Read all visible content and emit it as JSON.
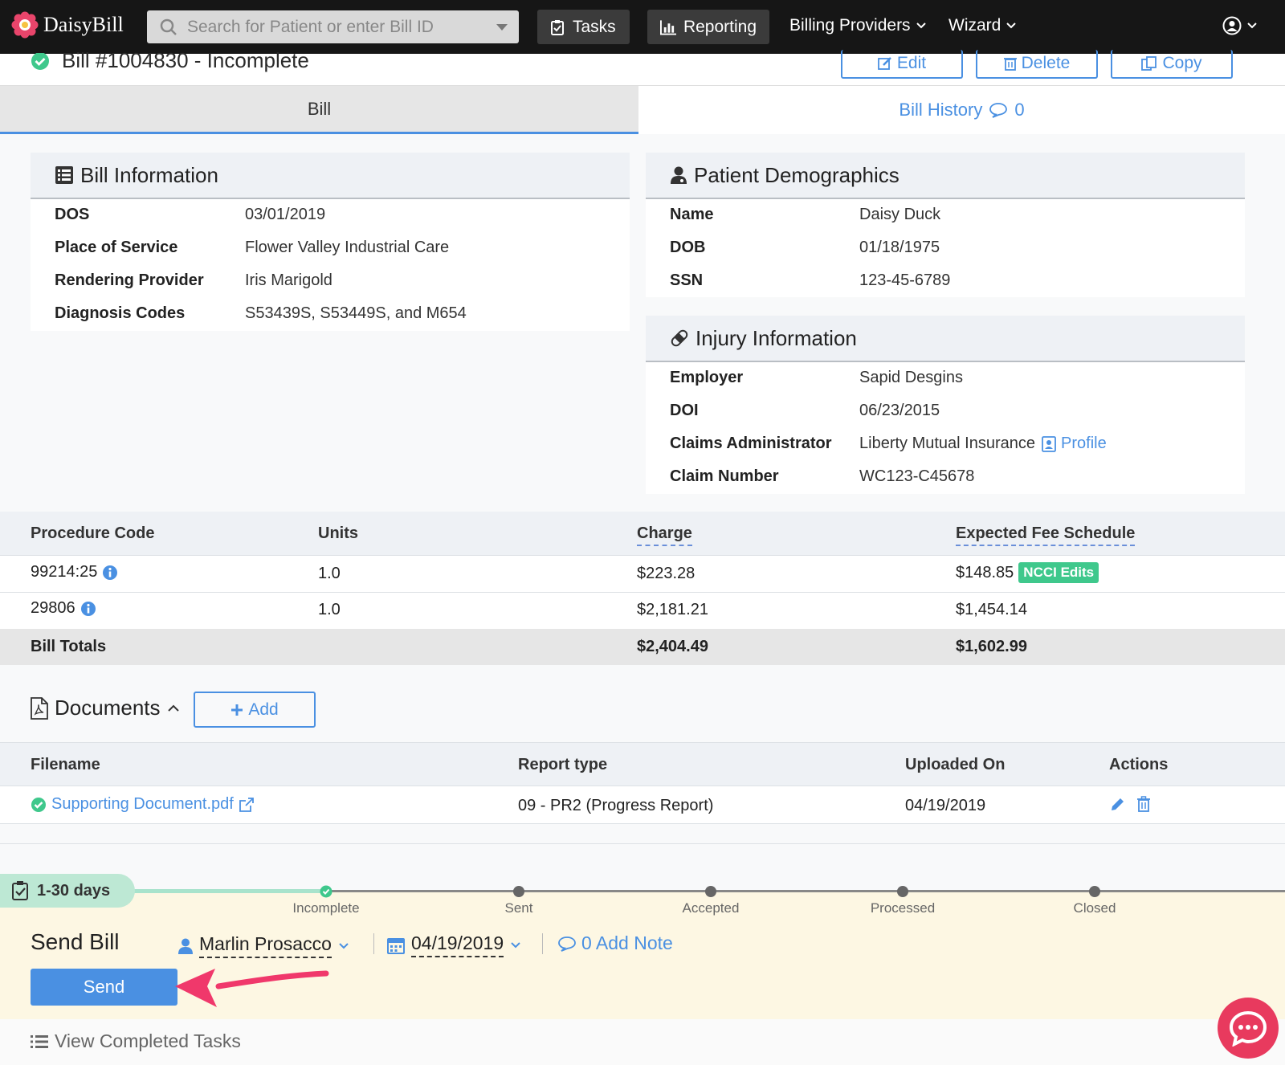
{
  "nav": {
    "brand": "DaisyBill",
    "search_placeholder": "Search for Patient or enter Bill ID",
    "tasks": "Tasks",
    "reporting": "Reporting",
    "billing_providers": "Billing Providers",
    "wizard": "Wizard"
  },
  "header": {
    "title": "Bill #1004830 - Incomplete",
    "edit": "Edit",
    "delete": "Delete",
    "copy": "Copy"
  },
  "tabs": {
    "bill": "Bill",
    "history": "Bill History",
    "history_count": "0"
  },
  "bill_info": {
    "heading": "Bill Information",
    "rows": [
      {
        "label": "DOS",
        "value": "03/01/2019"
      },
      {
        "label": "Place of Service",
        "value": "Flower Valley Industrial Care"
      },
      {
        "label": "Rendering Provider",
        "value": "Iris Marigold"
      },
      {
        "label": "Diagnosis Codes",
        "value": "S53439S, S53449S, and M654"
      }
    ]
  },
  "patient": {
    "heading": "Patient Demographics",
    "rows": [
      {
        "label": "Name",
        "value": "Daisy Duck"
      },
      {
        "label": "DOB",
        "value": "01/18/1975"
      },
      {
        "label": "SSN",
        "value": "123-45-6789"
      }
    ]
  },
  "injury": {
    "heading": "Injury Information",
    "rows": [
      {
        "label": "Employer",
        "value": "Sapid Desgins"
      },
      {
        "label": "DOI",
        "value": "06/23/2015"
      },
      {
        "label": "Claims Administrator",
        "value": "Liberty Mutual Insurance"
      },
      {
        "label": "Claim Number",
        "value": "WC123-C45678"
      }
    ],
    "profile_link": "Profile"
  },
  "procedures": {
    "headers": [
      "Procedure Code",
      "Units",
      "Charge",
      "Expected Fee Schedule"
    ],
    "rows": [
      {
        "code": "99214:25",
        "units": "1.0",
        "charge": "$223.28",
        "fee": "$148.85",
        "badge": "NCCI Edits"
      },
      {
        "code": "29806",
        "units": "1.0",
        "charge": "$2,181.21",
        "fee": "$1,454.14"
      }
    ],
    "totals_label": "Bill Totals",
    "total_charge": "$2,404.49",
    "total_fee": "$1,602.99"
  },
  "documents": {
    "heading": "Documents",
    "add": "Add",
    "headers": [
      "Filename",
      "Report type",
      "Uploaded On",
      "Actions"
    ],
    "rows": [
      {
        "filename": "Supporting Document.pdf",
        "report_type": "09 - PR2 (Progress Report)",
        "uploaded": "04/19/2019"
      }
    ]
  },
  "workflow": {
    "days_badge": "1-30 days",
    "steps": [
      "Incomplete",
      "Sent",
      "Accepted",
      "Processed",
      "Closed"
    ],
    "task_title": "Send Bill",
    "assignee": "Marlin Prosacco",
    "due_date": "04/19/2019",
    "add_note": "0 Add Note",
    "send": "Send",
    "view_completed": "View Completed Tasks"
  },
  "colors": {
    "accent": "#4a90e2",
    "success": "#3fc88c",
    "task_bg": "#fdf7e3",
    "arrow": "#f0386b",
    "chat": "#e83a5e"
  }
}
